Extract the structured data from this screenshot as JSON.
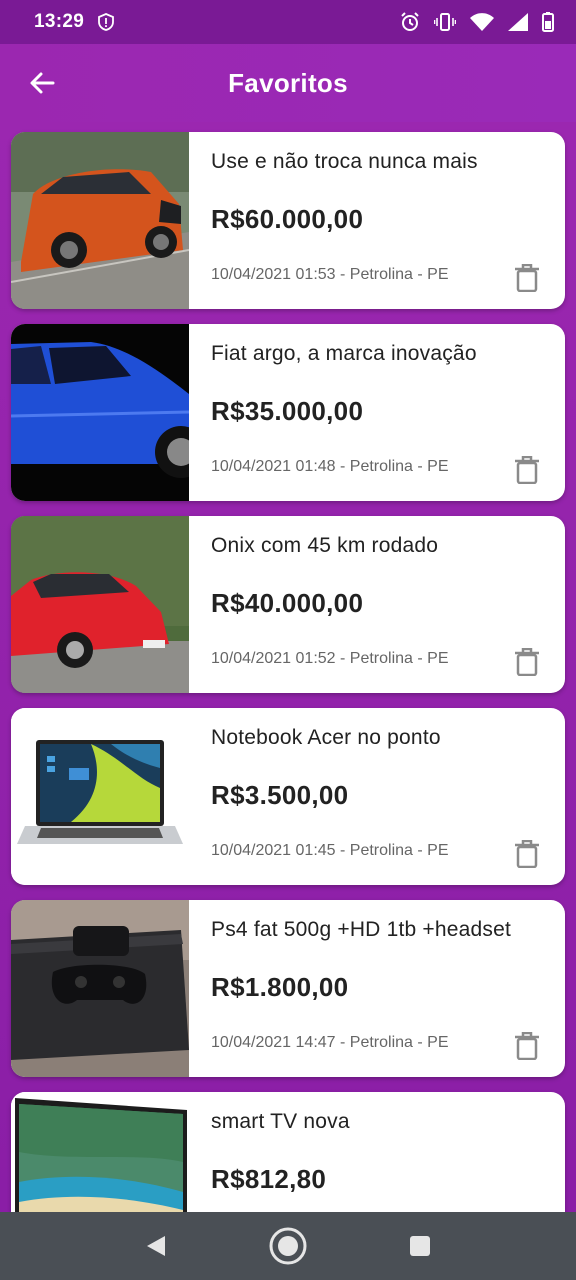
{
  "status": {
    "time": "13:29"
  },
  "header": {
    "title": "Favoritos"
  },
  "items": [
    {
      "title": "Use e não troca nunca mais",
      "price": "R$60.000,00",
      "meta": "10/04/2021 01:53 - Petrolina - PE",
      "image": "orange-hatchback-photo"
    },
    {
      "title": "Fiat argo, a marca inovação",
      "price": "R$35.000,00",
      "meta": "10/04/2021 01:48 - Petrolina - PE",
      "image": "blue-car-photo"
    },
    {
      "title": "Onix com 45 km rodado",
      "price": "R$40.000,00",
      "meta": "10/04/2021 01:52 - Petrolina - PE",
      "image": "red-car-photo"
    },
    {
      "title": "Notebook Acer no ponto",
      "price": "R$3.500,00",
      "meta": "10/04/2021 01:45 - Petrolina - PE",
      "image": "laptop-photo"
    },
    {
      "title": "Ps4 fat 500g +HD 1tb +headset",
      "price": "R$1.800,00",
      "meta": "10/04/2021 14:47 - Petrolina - PE",
      "image": "console-photo"
    },
    {
      "title": "smart TV nova",
      "price": "R$812,80",
      "meta": "",
      "image": "tv-photo"
    }
  ],
  "colors": {
    "accent": "#9b27b0",
    "statusbar": "#7a1a95",
    "navbar": "#4a4f55"
  }
}
